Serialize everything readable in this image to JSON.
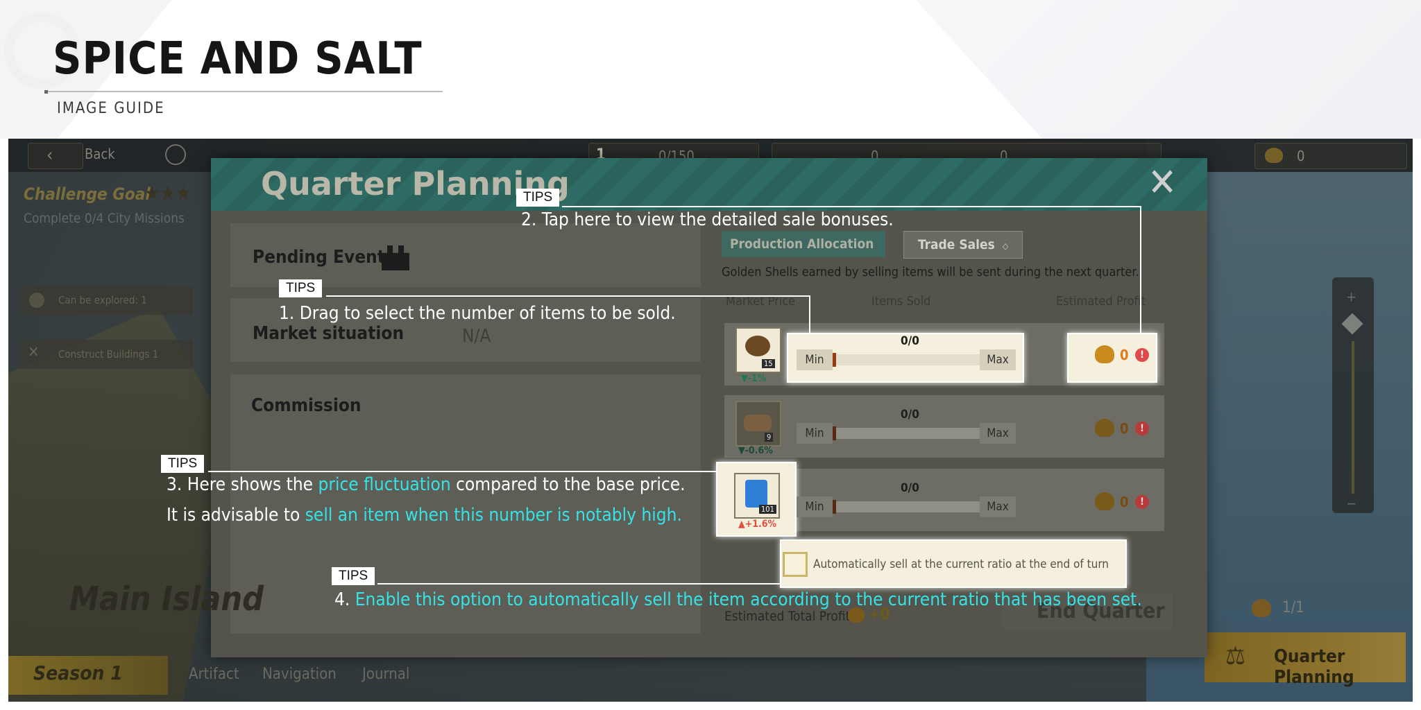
{
  "header": {
    "title": "SPICE AND SALT",
    "subtitle": "IMAGE GUIDE"
  },
  "game": {
    "topbar": {
      "back_label": "Back",
      "level": "1",
      "capacity": "0/150",
      "shell_count_1": "0",
      "shell_count_2": "0",
      "shell_count_3": "0"
    },
    "challenge": {
      "title": "Challenge Goal",
      "desc": "Complete 0/4 City Missions"
    },
    "side_rows": [
      "Can be explored: 1",
      "Construct Buildings 1"
    ],
    "map_label": "Main Island",
    "season_label": "Season 1",
    "bottom_nav": [
      "Artifact",
      "Navigation",
      "Journal"
    ],
    "quarter_planning_button": "Quarter Planning",
    "counter": "1/1"
  },
  "dialog": {
    "title": "Quarter Planning",
    "close_icon": "close-x-icon",
    "left_panels": {
      "pending_events": "Pending Events",
      "market_situation": "Market situation",
      "market_value": "N/A",
      "commission": "Commission"
    },
    "tabs": [
      "Production Allocation",
      "Trade Sales"
    ],
    "golden_shells_note": "Golden Shells earned by selling items will be sent during the next quarter.",
    "columns": [
      "Market Price",
      "Items Sold",
      "Estimated Profit"
    ],
    "rows": [
      {
        "item": "coconut-icon",
        "stock": "15",
        "change": "▼-1%",
        "sold": "0/0",
        "min": "Min",
        "max": "Max",
        "profit": "0",
        "change_color": "#1e7a4e"
      },
      {
        "item": "wood-logs-icon",
        "stock": "9",
        "change": "▼-0.6%",
        "sold": "0/0",
        "min": "Min",
        "max": "Max",
        "profit": "0",
        "change_color": "#1e7a4e"
      },
      {
        "item": "canned-food-icon",
        "stock": "101",
        "change": "▲+1.6%",
        "sold": "0/0",
        "min": "Min",
        "max": "Max",
        "profit": "0",
        "change_color": "#e05040"
      }
    ],
    "auto_sell_label": "Automatically sell at the current ratio at the end of turn",
    "total_label": "Estimated Total Profit",
    "total_value": "+0",
    "end_quarter": "End Quarter"
  },
  "tips": {
    "tag": "TIPS",
    "tip1": "1. Drag to select the number of items to be sold.",
    "tip2": "2. Tap here to view the detailed sale bonuses.",
    "tip3_a": "3. Here shows the ",
    "tip3_b": "price fluctuation",
    "tip3_c": " compared to the base price.",
    "tip3_d": "It is advisable to ",
    "tip3_e": "sell an item when this number is notably high.",
    "tip4_a": "4. ",
    "tip4_b": "Enable this option to automatically sell the item according to the current ratio that has been set."
  },
  "colors": {
    "tip_highlight": "#34e3e6",
    "dialog_header": "#2d6b64",
    "gold": "#c98a1e"
  }
}
